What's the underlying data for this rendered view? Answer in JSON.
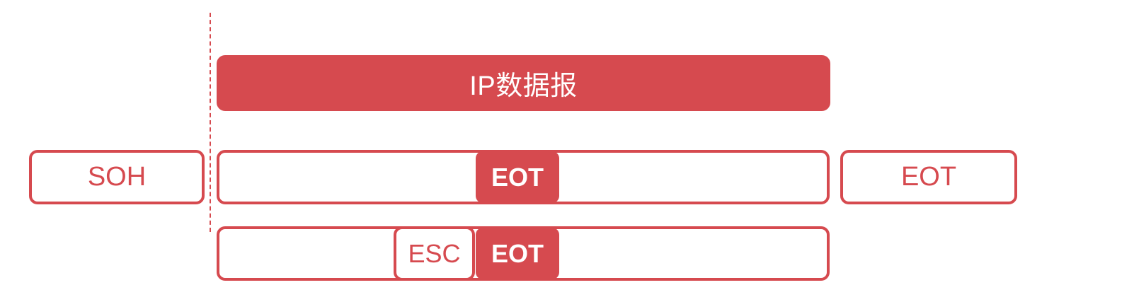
{
  "diagram": {
    "header": {
      "label": "IP数据报"
    },
    "row1": {
      "start_label": "SOH",
      "payload_tag": "EOT",
      "end_label": "EOT"
    },
    "row2": {
      "escape_label": "ESC",
      "payload_tag": "EOT"
    },
    "colors": {
      "accent": "#d64a4f",
      "background": "#ffffff"
    }
  }
}
